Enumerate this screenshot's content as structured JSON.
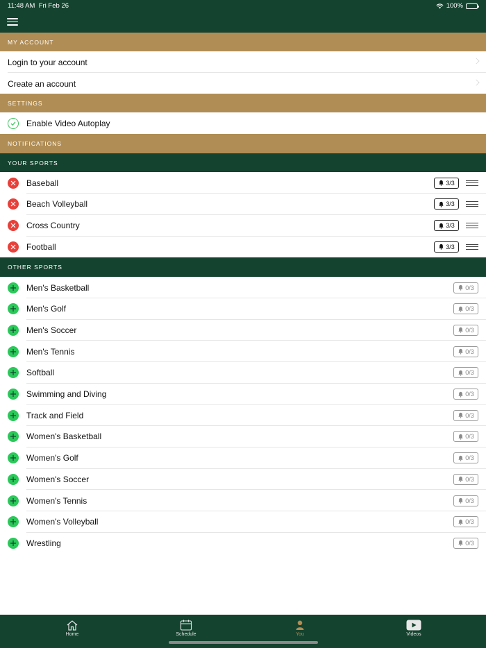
{
  "status": {
    "time": "11:48 AM",
    "date": "Fri Feb 26",
    "battery": "100%"
  },
  "sections": {
    "my_account": "MY ACCOUNT",
    "settings": "SETTINGS",
    "notifications": "NOTIFICATIONS",
    "your_sports": "YOUR SPORTS",
    "other_sports": "OTHER SPORTS"
  },
  "account": {
    "login": "Login to your account",
    "create": "Create an account"
  },
  "settings": {
    "autoplay": "Enable Video Autoplay"
  },
  "your_sports": [
    {
      "name": "Baseball",
      "alerts": "3/3"
    },
    {
      "name": "Beach Volleyball",
      "alerts": "3/3"
    },
    {
      "name": "Cross Country",
      "alerts": "3/3"
    },
    {
      "name": "Football",
      "alerts": "3/3"
    }
  ],
  "other_sports": [
    {
      "name": "Men's Basketball",
      "alerts": "0/3"
    },
    {
      "name": "Men's Golf",
      "alerts": "0/3"
    },
    {
      "name": "Men's Soccer",
      "alerts": "0/3"
    },
    {
      "name": "Men's Tennis",
      "alerts": "0/3"
    },
    {
      "name": "Softball",
      "alerts": "0/3"
    },
    {
      "name": "Swimming and Diving",
      "alerts": "0/3"
    },
    {
      "name": "Track and Field",
      "alerts": "0/3"
    },
    {
      "name": "Women's Basketball",
      "alerts": "0/3"
    },
    {
      "name": "Women's Golf",
      "alerts": "0/3"
    },
    {
      "name": "Women's Soccer",
      "alerts": "0/3"
    },
    {
      "name": "Women's Tennis",
      "alerts": "0/3"
    },
    {
      "name": "Women's Volleyball",
      "alerts": "0/3"
    },
    {
      "name": "Wrestling",
      "alerts": "0/3"
    }
  ],
  "tabs": [
    {
      "label": "Home",
      "icon": "home-icon"
    },
    {
      "label": "Schedule",
      "icon": "calendar-icon"
    },
    {
      "label": "You",
      "icon": "person-icon",
      "active": true
    },
    {
      "label": "Videos",
      "icon": "play-icon"
    }
  ],
  "colors": {
    "green": "#14432f",
    "gold": "#b08d55",
    "remove": "#e8403a",
    "add": "#2bc85a"
  }
}
